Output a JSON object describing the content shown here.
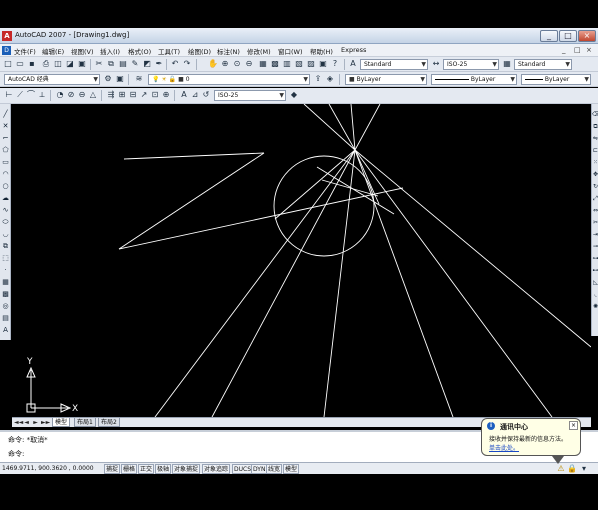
{
  "window": {
    "title": "AutoCAD 2007 - [Drawing1.dwg]",
    "controls": [
      "_",
      "□",
      "×"
    ]
  },
  "menu": {
    "items": [
      "文件(F)",
      "编辑(E)",
      "视图(V)",
      "插入(I)",
      "格式(O)",
      "工具(T)",
      "绘图(D)",
      "标注(N)",
      "修改(M)",
      "窗口(W)",
      "帮助(H)",
      "Express"
    ],
    "doc_controls": [
      "_",
      "□",
      "×"
    ]
  },
  "toolbar1": {
    "text_style": "Standard",
    "dim_style": "ISO-25",
    "table_style": "Standard"
  },
  "toolbar2": {
    "workspace": "AutoCAD 经典",
    "layer": "0",
    "color": "ByLayer",
    "linetype": "ByLayer",
    "lineweight": "ByLayer"
  },
  "toolbar3": {
    "dim_style": "ISO-25"
  },
  "drawing": {
    "ucs_x_label": "X",
    "ucs_y_label": "Y",
    "colors": {
      "background": "#000000",
      "lines": "#ffffff"
    }
  },
  "layout_tabs": {
    "nav": [
      "◄◄",
      "◄",
      "►",
      "►►"
    ],
    "tabs": [
      "模型",
      "布局1",
      "布局2"
    ]
  },
  "command": {
    "line1": "命令: *取消*",
    "line2": "命令:"
  },
  "status": {
    "coords": "1469.9711, 900.3620 , 0.0000",
    "buttons": [
      "捕捉",
      "栅格",
      "正交",
      "极轴",
      "对象捕捉",
      "对象追踪",
      "DUCS",
      "DYN",
      "线宽",
      "模型"
    ]
  },
  "balloon": {
    "title": "通讯中心",
    "text": "接收并保持最新的信息方法。",
    "link": "单击此处。"
  }
}
